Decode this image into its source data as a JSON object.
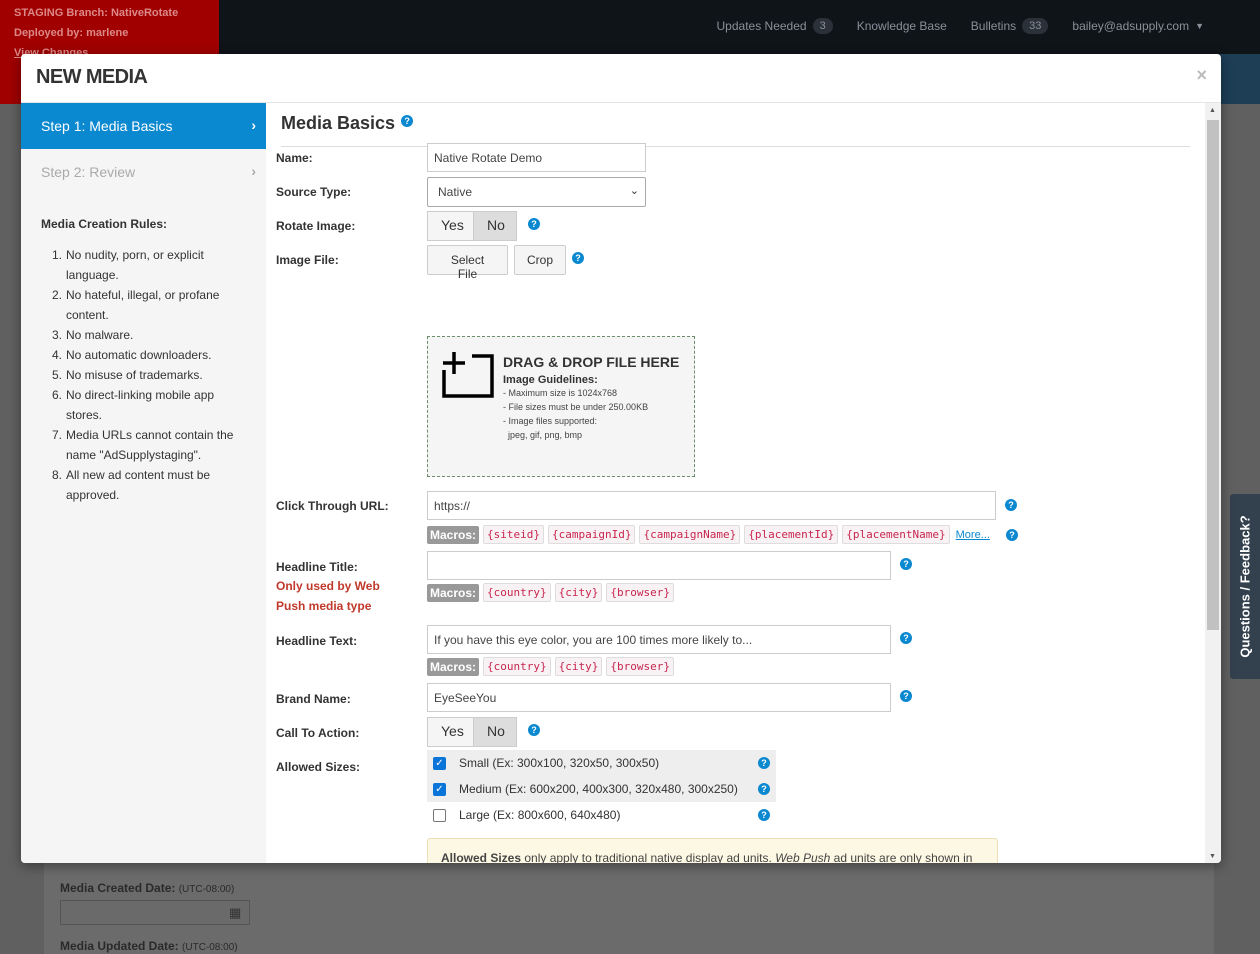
{
  "background": {
    "staging_lines": [
      "STAGING Branch: NativeRotate",
      "Deployed by: marlene"
    ],
    "view_changes": "View Changes",
    "nav": {
      "updates_label": "Updates Needed",
      "updates_count": "3",
      "kb_label": "Knowledge Base",
      "bulletins_label": "Bulletins",
      "bulletins_count": "33",
      "user_email": "bailey@adsupply.com"
    },
    "created_label": "Media Created Date:",
    "created_tz": "(UTC-08:00)",
    "updated_label": "Media Updated Date:",
    "updated_tz": "(UTC-08:00)"
  },
  "feedback_tab": "Questions / Feedback?",
  "modal": {
    "title": "NEW MEDIA",
    "close": "×"
  },
  "sidebar": {
    "steps": [
      {
        "label": "Step 1: Media Basics",
        "active": true
      },
      {
        "label": "Step 2: Review",
        "active": false
      }
    ],
    "rules_title": "Media Creation Rules:",
    "rules": [
      {
        "num": "1.",
        "lines": [
          "No nudity, porn, or explicit",
          "language."
        ]
      },
      {
        "num": "2.",
        "lines": [
          "No hateful, illegal, or profane",
          "content."
        ]
      },
      {
        "num": "3.",
        "lines": [
          "No malware."
        ]
      },
      {
        "num": "4.",
        "lines": [
          "No automatic downloaders."
        ]
      },
      {
        "num": "5.",
        "lines": [
          "No misuse of trademarks."
        ]
      },
      {
        "num": "6.",
        "lines": [
          "No direct-linking mobile app stores."
        ]
      },
      {
        "num": "7.",
        "lines": [
          "Media URLs cannot contain the",
          "name \"AdSupplystaging\"."
        ]
      },
      {
        "num": "8.",
        "lines": [
          "All new ad content must be",
          "approved."
        ]
      }
    ]
  },
  "form": {
    "section_title": "Media Basics",
    "name_label": "Name:",
    "name_value": "Native Rotate Demo",
    "source_label": "Source Type:",
    "source_value": "Native",
    "rotate_label": "Rotate Image:",
    "yes": "Yes",
    "no": "No",
    "image_label": "Image File:",
    "select_file": "Select File",
    "crop": "Crop",
    "dropzone": {
      "title": "DRAG & DROP FILE HERE",
      "guidelines_title": "Image Guidelines:",
      "lines": [
        "- Maximum size is 1024x768",
        "- File sizes must be under 250.00KB",
        "- Image files supported:",
        "  jpeg, gif, png, bmp"
      ]
    },
    "click_url_label": "Click Through URL:",
    "click_url_value": "https://",
    "macros_label": "Macros:",
    "url_macros": [
      "{siteid}",
      "{campaignId}",
      "{campaignName}",
      "{placementId}",
      "{placementName}"
    ],
    "more": "More...",
    "headline_title_label": "Headline Title:",
    "headline_title_note_1": "Only used by Web",
    "headline_title_note_2": "Push media type",
    "headline_title_value": "",
    "geo_macros": [
      "{country}",
      "{city}",
      "{browser}"
    ],
    "headline_text_label": "Headline Text:",
    "headline_text_value": "If you have this eye color, you are 100 times more likely to...",
    "brand_label": "Brand Name:",
    "brand_value": "EyeSeeYou",
    "cta_label": "Call To Action:",
    "sizes_label": "Allowed Sizes:",
    "sizes": [
      {
        "label": "Small (Ex: 300x100, 320x50, 300x50)",
        "checked": true
      },
      {
        "label": "Medium (Ex: 600x200, 400x300, 320x480, 300x250)",
        "checked": true
      },
      {
        "label": "Large (Ex: 800x600, 640x480)",
        "checked": false
      }
    ],
    "notice": {
      "bold": "Allowed Sizes",
      "text1": " only apply to traditional native display ad units. ",
      "italic": "Web Push",
      "text2": " ad units are only shown in standard browser notification size and will not respect these values."
    }
  }
}
